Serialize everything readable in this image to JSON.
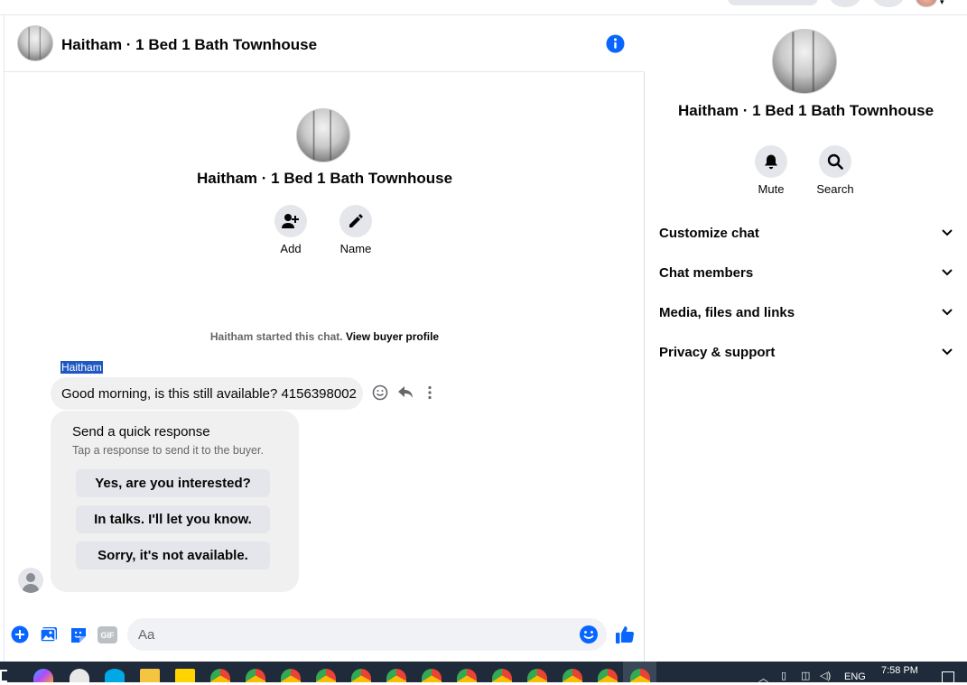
{
  "header": {
    "title": "Haitham · 1 Bed 1 Bath Townhouse",
    "info_icon": "info-icon",
    "colors": {
      "accent": "#0866ff"
    }
  },
  "intro": {
    "title": "Haitham · 1 Bed 1 Bath Townhouse",
    "actions": [
      {
        "label": "Add",
        "icon": "add-person-icon"
      },
      {
        "label": "Name",
        "icon": "pencil-icon"
      }
    ]
  },
  "notice": {
    "text": "Haitham started this chat.",
    "link": "View buyer profile"
  },
  "message": {
    "sender": "Haitham",
    "text": "Good morning, is this still available? 4156398002",
    "actions": [
      "smiley-icon",
      "reply-icon",
      "more-icon"
    ]
  },
  "quick_response": {
    "title": "Send a quick response",
    "subtitle": "Tap a response to send it to the buyer.",
    "options": [
      "Yes, are you interested?",
      "In talks. I'll let you know.",
      "Sorry, it's not available."
    ]
  },
  "composer": {
    "placeholder": "Aa",
    "gif_label": "GIF",
    "icons": [
      "plus-circle-icon",
      "image-icon",
      "sticker-icon",
      "gif-icon",
      "emoji-icon",
      "thumbs-up-icon"
    ]
  },
  "panel": {
    "title": "Haitham · 1 Bed 1 Bath Townhouse",
    "actions": [
      {
        "label": "Mute",
        "icon": "bell-icon"
      },
      {
        "label": "Search",
        "icon": "search-icon"
      }
    ],
    "menu": [
      "Customize chat",
      "Chat members",
      "Media, files and links",
      "Privacy & support"
    ]
  },
  "taskbar": {
    "language": "ENG",
    "time": "7:58 PM"
  }
}
